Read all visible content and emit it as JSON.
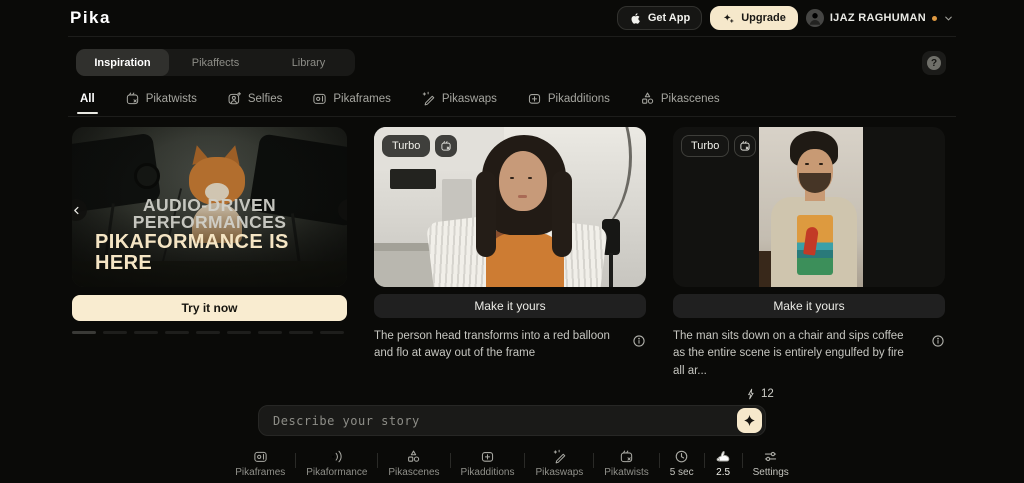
{
  "header": {
    "logo": "Pika",
    "get_app_label": "Get App",
    "upgrade_label": "Upgrade",
    "user_name": "IJAZ RAGHUMAN"
  },
  "help": {
    "label": "?"
  },
  "tabs": {
    "items": [
      {
        "label": "Inspiration",
        "active": true
      },
      {
        "label": "Pikaffects",
        "active": false
      },
      {
        "label": "Library",
        "active": false
      }
    ]
  },
  "filters": {
    "items": [
      {
        "label": "All",
        "active": true
      },
      {
        "label": "Pikatwists",
        "active": false
      },
      {
        "label": "Selfies",
        "active": false
      },
      {
        "label": "Pikaframes",
        "active": false
      },
      {
        "label": "Pikaswaps",
        "active": false
      },
      {
        "label": "Pikadditions",
        "active": false
      },
      {
        "label": "Pikascenes",
        "active": false
      }
    ]
  },
  "promo": {
    "title_line1": "AUDIO-DRIVEN",
    "title_line2": "PERFORMANCES",
    "title_line3": "PIKAFORMANCE IS",
    "title_line4": "HERE",
    "cta_label": "Try it now",
    "carousel_dots": 9
  },
  "examples": [
    {
      "badge": "Turbo",
      "action_label": "Make it yours",
      "description": "The person head transforms into a red balloon and flo at away out of the frame"
    },
    {
      "badge": "Turbo",
      "action_label": "Make it yours",
      "description": "The man sits down on a chair and sips coffee as the entire scene is entirely engulfed by fire all ar...",
      "credits": "12"
    }
  ],
  "prompt": {
    "placeholder": "Describe your story"
  },
  "toolbar": {
    "tools": [
      {
        "label": "Pikaframes"
      },
      {
        "label": "Pikaformance"
      },
      {
        "label": "Pikascenes"
      },
      {
        "label": "Pikadditions"
      },
      {
        "label": "Pikaswaps"
      },
      {
        "label": "Pikatwists"
      }
    ],
    "duration_label": "5 sec",
    "model_label": "2.5",
    "settings_label": "Settings"
  },
  "colors": {
    "accent_cream": "#f6e8cb",
    "background": "#0a0a08",
    "notification_dot": "#e09a42"
  }
}
